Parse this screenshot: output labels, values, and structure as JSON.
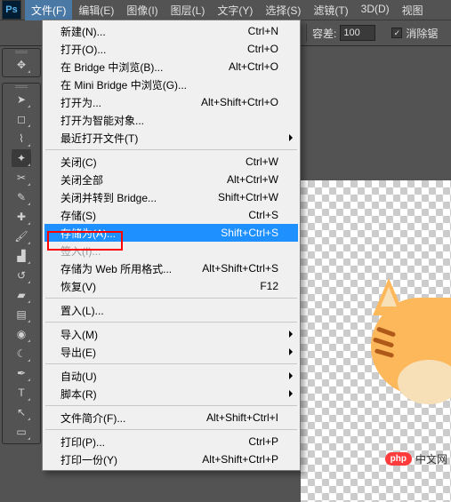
{
  "app": {
    "logo": "Ps"
  },
  "menubar": {
    "items": [
      {
        "label": "文件(F)",
        "active": true
      },
      {
        "label": "编辑(E)"
      },
      {
        "label": "图像(I)"
      },
      {
        "label": "图层(L)"
      },
      {
        "label": "文字(Y)"
      },
      {
        "label": "选择(S)"
      },
      {
        "label": "滤镜(T)"
      },
      {
        "label": "3D(D)"
      },
      {
        "label": "视图"
      }
    ]
  },
  "options_bar": {
    "opacity_label": "容差:",
    "opacity_value": "100",
    "checkbox_checked": true,
    "checkbox_label": "消除锯"
  },
  "tools": {
    "groups": [
      {
        "items": [
          {
            "name": "move-tool-icon",
            "glyph": "✥"
          }
        ]
      },
      {
        "items": [
          {
            "name": "move-tool-icon",
            "glyph": "➤"
          },
          {
            "name": "marquee-tool-icon",
            "glyph": "◻"
          },
          {
            "name": "lasso-tool-icon",
            "glyph": "⌇"
          },
          {
            "name": "quick-select-tool-icon",
            "glyph": "✦",
            "selected": true
          },
          {
            "name": "crop-tool-icon",
            "glyph": "✂"
          },
          {
            "name": "eyedropper-tool-icon",
            "glyph": "✎"
          },
          {
            "name": "healing-tool-icon",
            "glyph": "✚"
          },
          {
            "name": "brush-tool-icon",
            "glyph": "🖌"
          },
          {
            "name": "stamp-tool-icon",
            "glyph": "▟"
          },
          {
            "name": "history-brush-tool-icon",
            "glyph": "↺"
          },
          {
            "name": "eraser-tool-icon",
            "glyph": "▰"
          },
          {
            "name": "gradient-tool-icon",
            "glyph": "▤"
          },
          {
            "name": "blur-tool-icon",
            "glyph": "◉"
          },
          {
            "name": "dodge-tool-icon",
            "glyph": "☾"
          },
          {
            "name": "pen-tool-icon",
            "glyph": "✒"
          },
          {
            "name": "type-tool-icon",
            "glyph": "T"
          },
          {
            "name": "path-select-tool-icon",
            "glyph": "↖"
          },
          {
            "name": "rectangle-tool-icon",
            "glyph": "▭"
          }
        ]
      }
    ]
  },
  "file_menu": {
    "sections": [
      [
        {
          "label": "新建(N)...",
          "shortcut": "Ctrl+N"
        },
        {
          "label": "打开(O)...",
          "shortcut": "Ctrl+O"
        },
        {
          "label": "在 Bridge 中浏览(B)...",
          "shortcut": "Alt+Ctrl+O"
        },
        {
          "label": "在 Mini Bridge 中浏览(G)..."
        },
        {
          "label": "打开为...",
          "shortcut": "Alt+Shift+Ctrl+O"
        },
        {
          "label": "打开为智能对象..."
        },
        {
          "label": "最近打开文件(T)",
          "submenu": true
        }
      ],
      [
        {
          "label": "关闭(C)",
          "shortcut": "Ctrl+W"
        },
        {
          "label": "关闭全部",
          "shortcut": "Alt+Ctrl+W"
        },
        {
          "label": "关闭并转到 Bridge...",
          "shortcut": "Shift+Ctrl+W"
        },
        {
          "label": "存储(S)",
          "shortcut": "Ctrl+S"
        },
        {
          "label": "存储为(A)...",
          "shortcut": "Shift+Ctrl+S",
          "highlight": true
        },
        {
          "label": "签入(I)...",
          "disabled": true
        },
        {
          "label": "存储为 Web 所用格式...",
          "shortcut": "Alt+Shift+Ctrl+S"
        },
        {
          "label": "恢复(V)",
          "shortcut": "F12"
        }
      ],
      [
        {
          "label": "置入(L)..."
        }
      ],
      [
        {
          "label": "导入(M)",
          "submenu": true
        },
        {
          "label": "导出(E)",
          "submenu": true
        }
      ],
      [
        {
          "label": "自动(U)",
          "submenu": true
        },
        {
          "label": "脚本(R)",
          "submenu": true
        }
      ],
      [
        {
          "label": "文件简介(F)...",
          "shortcut": "Alt+Shift+Ctrl+I"
        }
      ],
      [
        {
          "label": "打印(P)...",
          "shortcut": "Ctrl+P"
        },
        {
          "label": "打印一份(Y)",
          "shortcut": "Alt+Shift+Ctrl+P"
        }
      ]
    ]
  },
  "watermark": {
    "badge": "php",
    "text": "中文网"
  }
}
